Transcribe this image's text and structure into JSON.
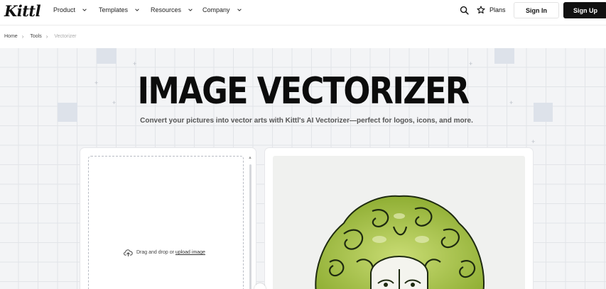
{
  "nav": {
    "logo": "Kittl",
    "items": [
      {
        "label": "Product"
      },
      {
        "label": "Templates"
      },
      {
        "label": "Resources"
      },
      {
        "label": "Company"
      }
    ],
    "plans_label": "Plans",
    "signin_label": "Sign In",
    "signup_label": "Sign Up"
  },
  "breadcrumb": {
    "items": [
      "Home",
      "Tools"
    ],
    "current": "Vectorizer"
  },
  "hero": {
    "title": "IMAGE VECTORIZER",
    "subtitle": "Convert your pictures into vector arts with Kittl's AI Vectorizer—perfect for logos, icons, and more."
  },
  "upload": {
    "prompt": "Drag and drop or",
    "link_label": "upload image"
  },
  "icons": {
    "search": "search-icon",
    "plans": "star-icon",
    "chevron": "chevron-down-icon",
    "separator": "chevron-right-icon",
    "upload": "cloud-upload-icon"
  },
  "colors": {
    "primary": "#111111",
    "hero_bg": "#f3f4f6",
    "illustration_green": "#a6c24a"
  }
}
